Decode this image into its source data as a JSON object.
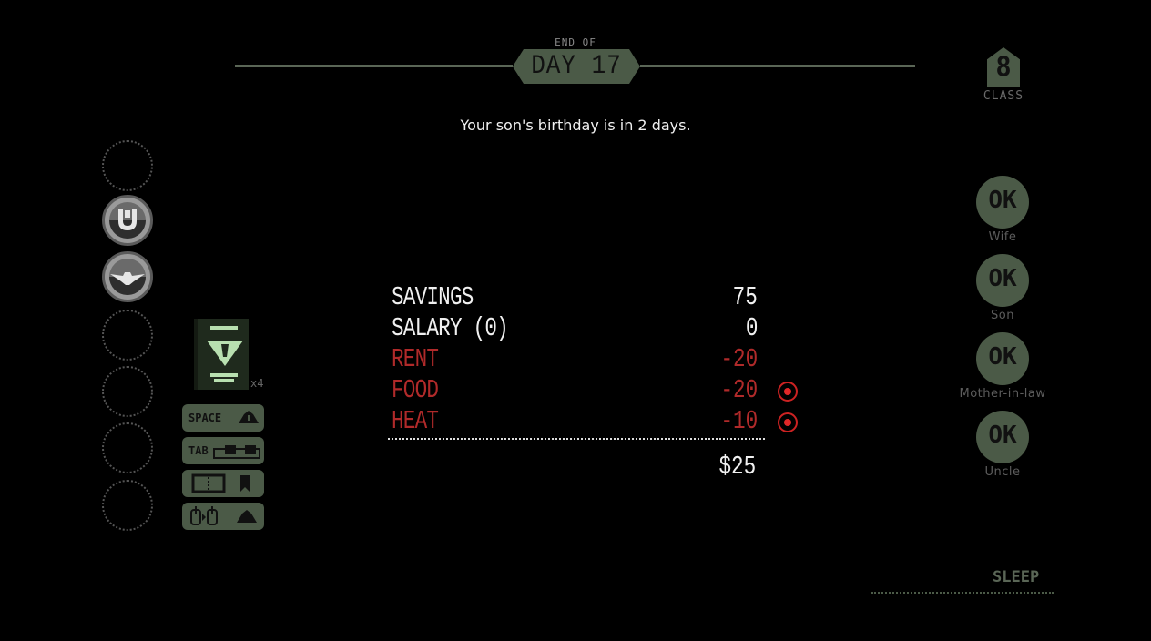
{
  "header": {
    "end_of_label": "END OF",
    "day_label": "DAY 17"
  },
  "class_badge": {
    "value": "8",
    "label": "CLASS"
  },
  "message": "Your son's birthday is in 2 days.",
  "tokens": [
    {
      "state": "empty"
    },
    {
      "state": "filled",
      "icon": "horseshoe-emblem-icon"
    },
    {
      "state": "filled",
      "icon": "eagle-emblem-icon"
    },
    {
      "state": "empty"
    },
    {
      "state": "empty"
    },
    {
      "state": "empty"
    },
    {
      "state": "empty"
    }
  ],
  "rulebook": {
    "icon": "rulebook-icon",
    "count": "x4"
  },
  "controls": [
    {
      "label": "SPACE",
      "icon": "stamp-tray-icon"
    },
    {
      "label": "TAB",
      "icon": "inspect-toggle-icon"
    },
    {
      "label": "",
      "icon": "book-bookmark-icon"
    },
    {
      "label": "",
      "icon": "mouse-drag-icon"
    }
  ],
  "ledger": {
    "rows": [
      {
        "label": "SAVINGS",
        "value": "75",
        "type": "pos",
        "alert": false
      },
      {
        "label": "SALARY (0)",
        "value": "0",
        "type": "pos",
        "alert": false
      },
      {
        "label": "RENT",
        "value": "-20",
        "type": "neg",
        "alert": false
      },
      {
        "label": "FOOD",
        "value": "-20",
        "type": "neg",
        "alert": true
      },
      {
        "label": "HEAT",
        "value": "-10",
        "type": "neg",
        "alert": true
      }
    ],
    "total": "$25"
  },
  "family": [
    {
      "status": "OK",
      "name": "Wife"
    },
    {
      "status": "OK",
      "name": "Son"
    },
    {
      "status": "OK",
      "name": "Mother-in-law"
    },
    {
      "status": "OK",
      "name": "Uncle"
    }
  ],
  "sleep_label": "SLEEP",
  "colors": {
    "accent_green": "#4b5a47",
    "expense_red": "#b02a2a",
    "alert_red": "#e02828"
  }
}
